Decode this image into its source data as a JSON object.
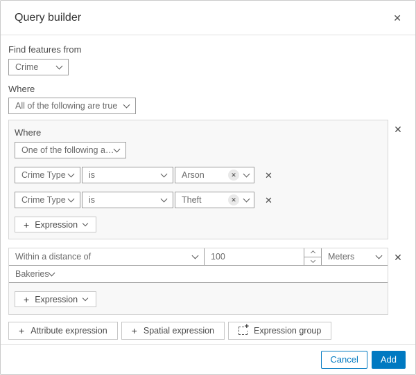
{
  "dialog": {
    "title": "Query builder"
  },
  "icons": {
    "close": "✕",
    "plus": "+"
  },
  "form": {
    "find_features_label": "Find features from",
    "layer_select_value": "Crime",
    "where_label": "Where",
    "top_operator_value": "All of the following are true"
  },
  "group1": {
    "where_label": "Where",
    "operator_value": "One of the following are tr...",
    "rows": [
      {
        "field": "Crime Type",
        "operator": "is",
        "value": "Arson"
      },
      {
        "field": "Crime Type",
        "operator": "is",
        "value": "Theft"
      }
    ],
    "add_expression_label": "Expression"
  },
  "group2": {
    "spatial_operator_value": "Within a distance of",
    "distance_value": "100",
    "unit_value": "Meters",
    "layer_value": "Bakeries",
    "add_expression_label": "Expression"
  },
  "actions": {
    "attribute_expression_label": "Attribute expression",
    "spatial_expression_label": "Spatial expression",
    "expression_group_label": "Expression group"
  },
  "footer": {
    "cancel_label": "Cancel",
    "add_label": "Add"
  },
  "colors": {
    "accent": "#0079c1",
    "group_bg": "#f8f8f8",
    "field_border": "#9b9b9b"
  }
}
